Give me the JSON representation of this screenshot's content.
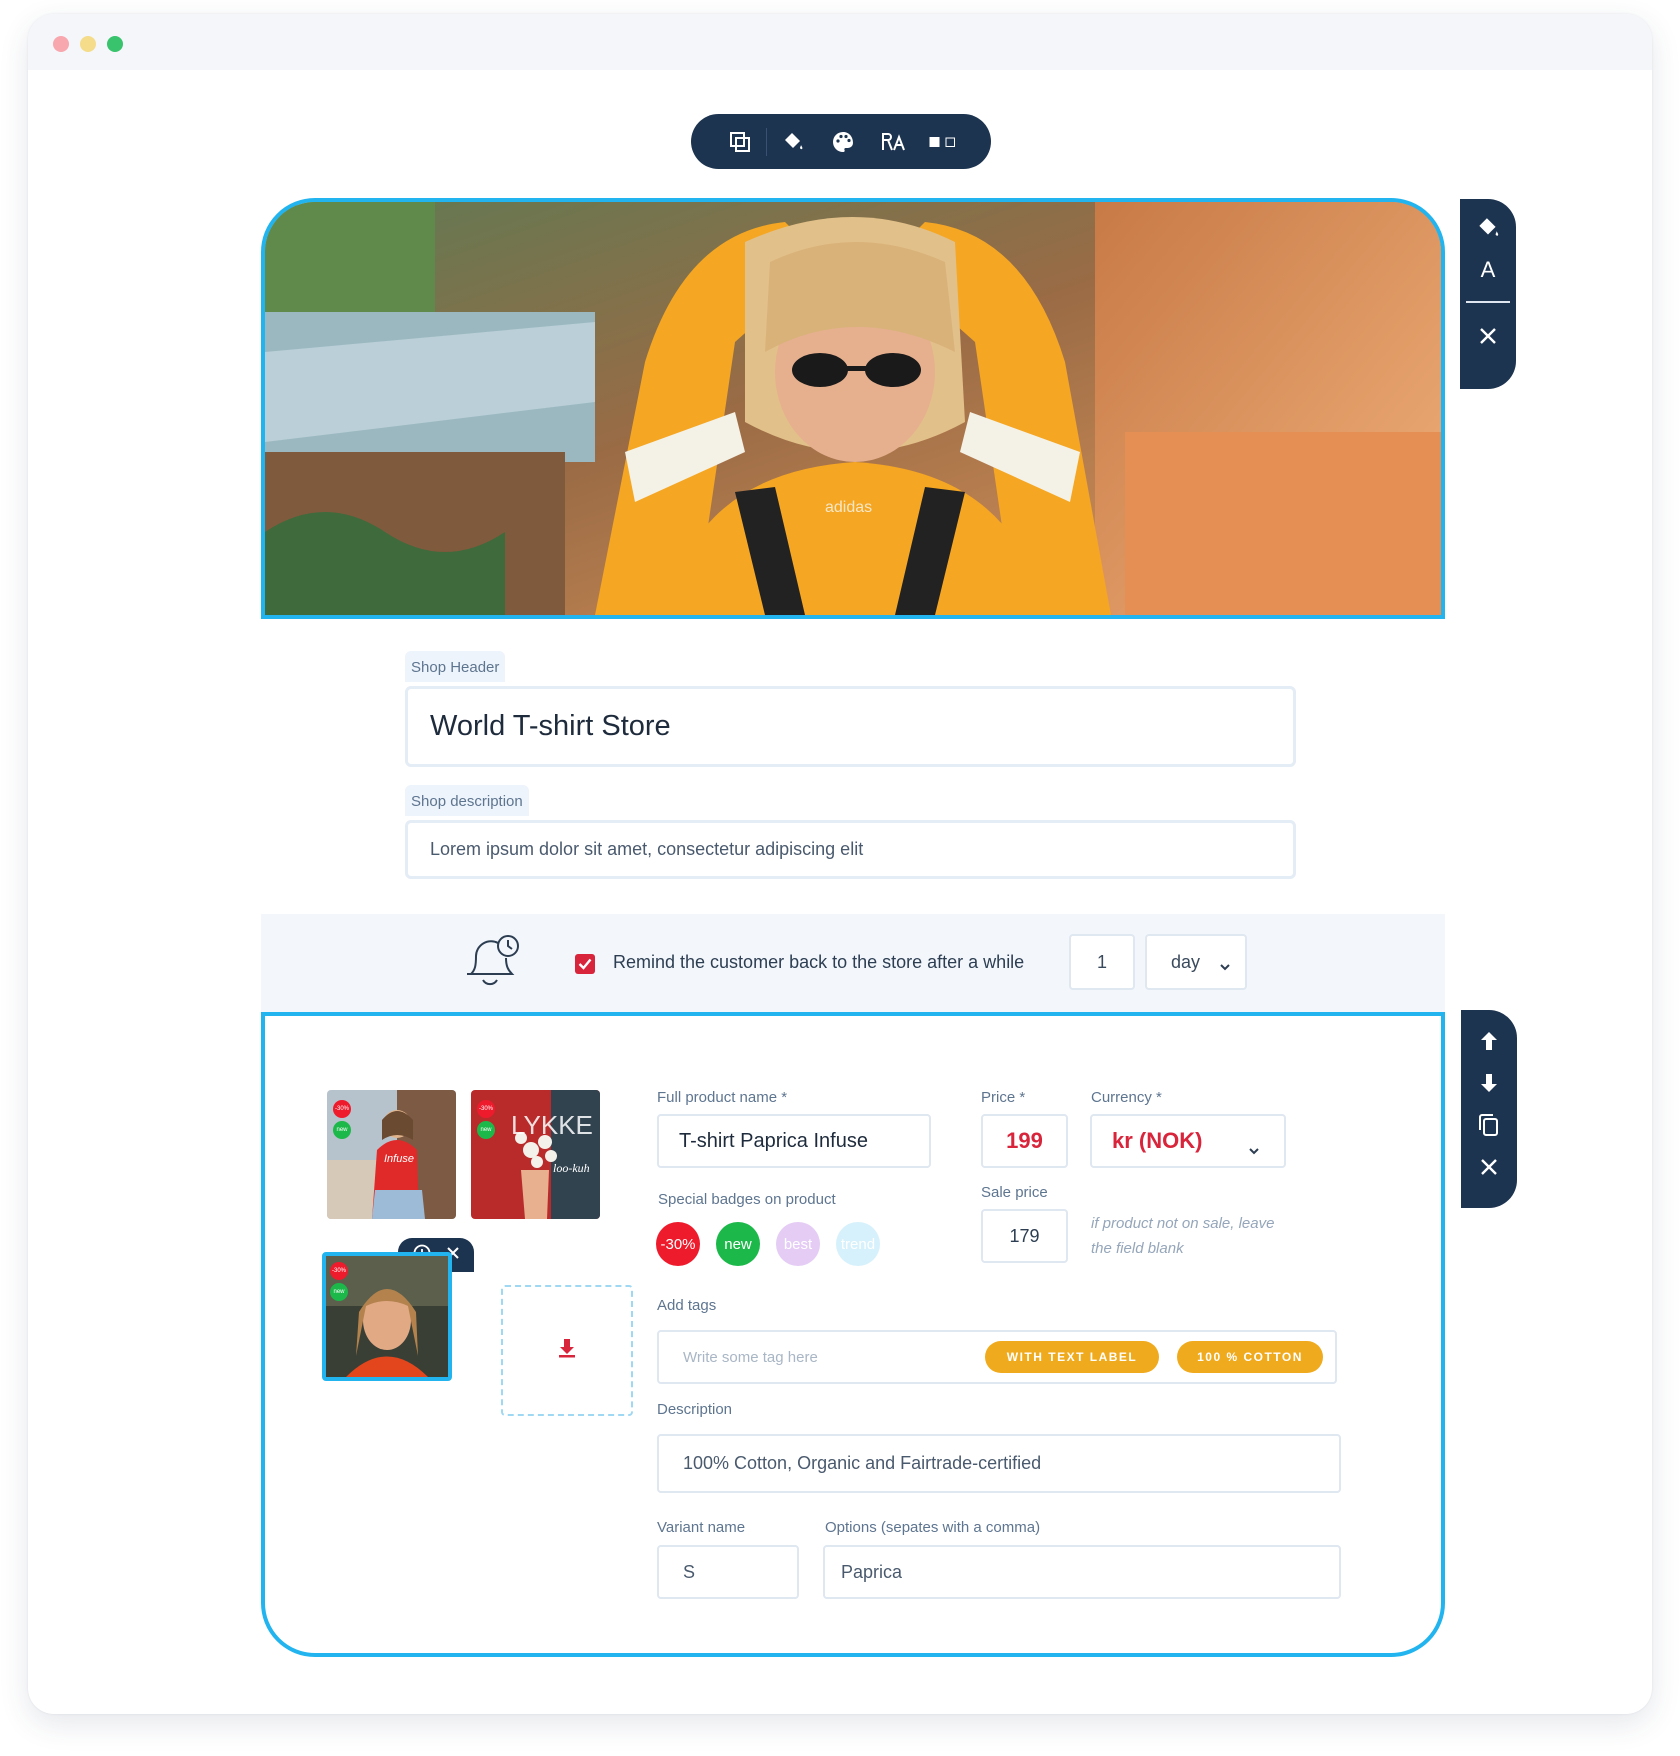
{
  "colors": {
    "accent": "#22b4ef",
    "toolbar_bg": "#1d3450",
    "price_red": "#d9253c",
    "tag_orange": "#f0aa1d",
    "badge_sale": "#ee1b2c",
    "badge_new": "#1cb84a",
    "badge_best": "#e4ccf5",
    "badge_trend": "#d6f1fb"
  },
  "top_toolbar": {
    "icons": [
      "layout-icon",
      "fill-color-icon",
      "palette-icon",
      "font-size-icon",
      "frame-style-icon"
    ]
  },
  "side_toolbar_top": {
    "icons": [
      "fill-color-icon",
      "text-color-icon",
      "close-icon"
    ],
    "text_icon_glyph": "A"
  },
  "side_toolbar_product": {
    "icons": [
      "move-up-icon",
      "move-down-icon",
      "duplicate-icon",
      "close-icon"
    ]
  },
  "shop": {
    "header_label": "Shop Header",
    "header_value": "World T-shirt Store",
    "description_label": "Shop description",
    "description_value": "Lorem ipsum dolor sit amet, consectetur adipiscing elit"
  },
  "reminder": {
    "checked": true,
    "label": "Remind the customer back to the store after a while",
    "amount": "1",
    "unit": "day"
  },
  "product": {
    "thumb_badges": {
      "sale": "-30%",
      "new": "new"
    },
    "thumb_overlay_text": "LYKKE",
    "thumb_overlay_sub": "loo-kuh",
    "thumb_shirt_text": "Infuse",
    "name_label": "Full product name *",
    "name_value": "T-shirt Paprica Infuse",
    "price_label": "Price *",
    "price_value": "199",
    "currency_label": "Currency *",
    "currency_value": "kr (NOK)",
    "sale_price_label": "Sale price",
    "sale_price_value": "179",
    "sale_hint": "if product not on sale, leave the field blank",
    "badges_label": "Special badges on product",
    "badges": [
      "-30%",
      "new",
      "best",
      "trend"
    ],
    "tags_label": "Add tags",
    "tags_placeholder": "Write some tag here",
    "tags": [
      "WITH TEXT LABEL",
      "100 % COTTON"
    ],
    "description_label": "Description",
    "description_value": "100% Cotton, Organic and Fairtrade-certified",
    "variant_label": "Variant name",
    "variant_value": "S",
    "options_label": "Options (sepates with a comma)",
    "options_value": "Paprica"
  }
}
